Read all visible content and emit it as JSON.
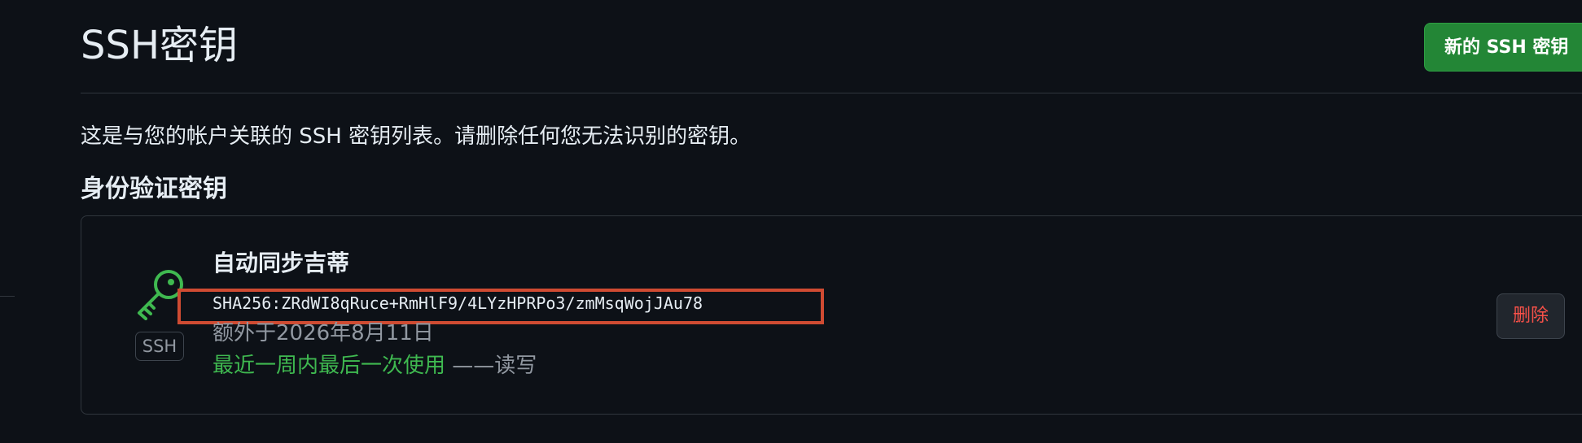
{
  "header": {
    "title": "SSH密钥",
    "new_key_button": "新的 SSH 密钥"
  },
  "description": "这是与您的帐户关联的 SSH 密钥列表。请删除任何您无法识别的密钥。",
  "section_heading": "身份验证密钥",
  "keys": [
    {
      "title": "自动同步吉蒂",
      "fingerprint": "SHA256:ZRdWI8qRuce+RmHlF9/4LYzHPRPo3/zmMsqWojJAu78",
      "added": "额外于2026年8月11日",
      "last_used": "最近一周内最后一次使用",
      "access": "——读写",
      "badge": "SSH",
      "icon": "key-icon",
      "delete_label": "删除"
    }
  ],
  "colors": {
    "background": "#0d1117",
    "accent_green": "#238636",
    "success_text": "#3fb950",
    "danger_text": "#f85149",
    "highlight": "#cf4b32"
  }
}
